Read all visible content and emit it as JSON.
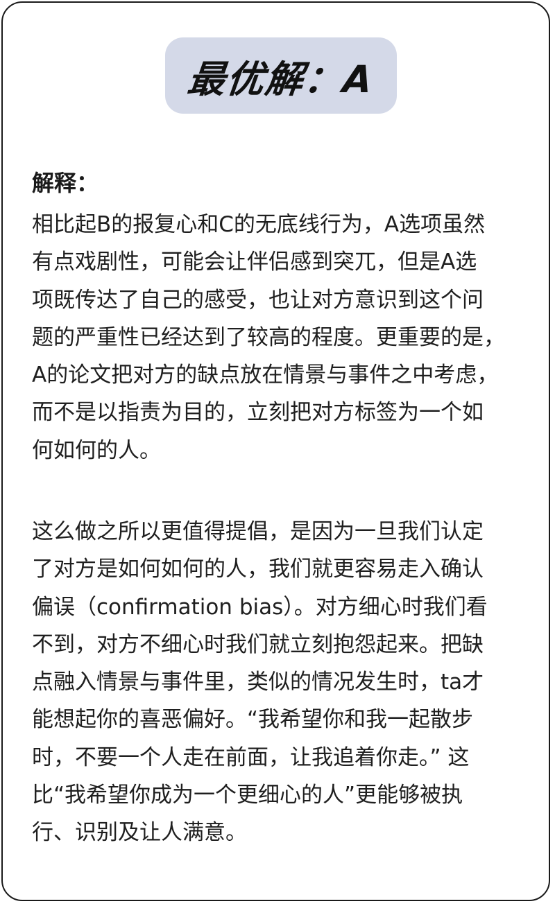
{
  "title": "最优解：A",
  "explanation_label": "解释：",
  "paragraphs": [
    {
      "lines": [
        "相比起B的报复心和C的无底线行为，A选项虽然",
        "有点戏剧性，可能会让伴侣感到突兀，但是A选",
        "项既传达了自己的感受，也让对方意识到这个问",
        "题的严重性已经达到了较高的程度。更重要的是，",
        "A的论文把对方的缺点放在情景与事件之中考虑，",
        "而不是以指责为目的，立刻把对方标签为一个如",
        "何如何的人。"
      ]
    },
    {
      "lines": [
        "这么做之所以更值得提倡，是因为一旦我们认定",
        "了对方是如何如何的人，我们就更容易走入确认",
        "偏误（confirmation bias）。对方细心时我们看",
        "不到，对方不细心时我们就立刻抱怨起来。把缺",
        "点融入情景与事件里，类似的情况发生时，ta才",
        "能想起你的喜恶偏好。“我希望你和我一起散步",
        "时，不要一个人走在前面，让我追着你走。” 这",
        "比“我希望你成为一个更细心的人”更能够被执",
        "行、识别及让人满意。"
      ]
    }
  ]
}
